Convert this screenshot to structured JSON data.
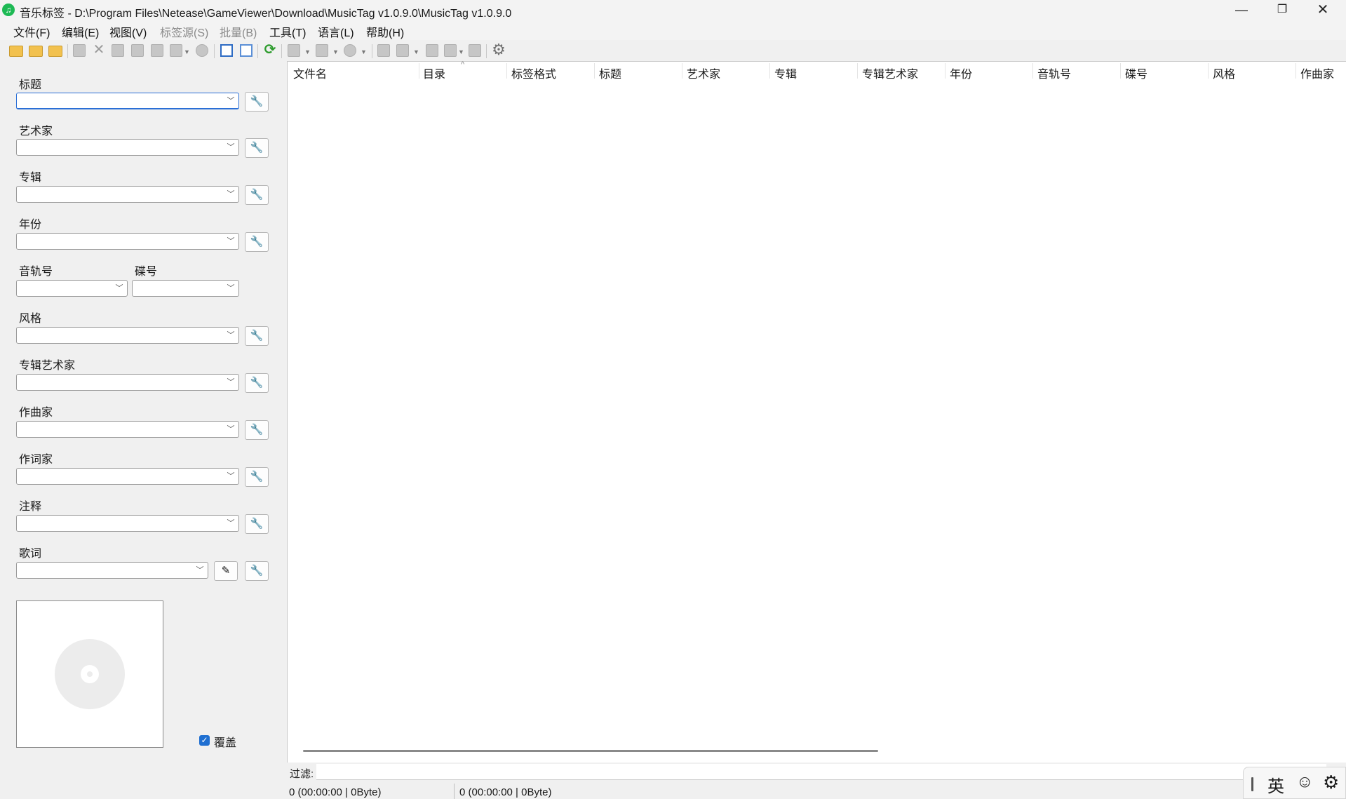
{
  "window": {
    "title": "音乐标签 - D:\\Program Files\\Netease\\GameViewer\\Download\\MusicTag v1.0.9.0\\MusicTag v1.0.9.0",
    "app_icon_glyph": "♫",
    "minimize_glyph": "—",
    "maximize_glyph": "❐",
    "close_glyph": "✕"
  },
  "menu": [
    "文件(F)",
    "编辑(E)",
    "视图(V)",
    "标签源(S)",
    "批量(B)",
    "工具(T)",
    "语言(L)",
    "帮助(H)"
  ],
  "menu_disabled": [
    "标签源(S)",
    "批量(B)"
  ],
  "toolbar_icons": [
    "open-folder-icon",
    "add-folder-icon",
    "open-subfolder-icon",
    "save-icon",
    "delete-icon",
    "undo-icon",
    "book-icon",
    "tag-tool-icon",
    "filter-tool-icon",
    "history-icon",
    "grid-view-icon",
    "list-grid-icon",
    "refresh-icon",
    "export-icon",
    "table-export-icon",
    "cd-icon",
    "tools-icon",
    "copy-icon",
    "rename-icon",
    "filter-icon",
    "convert-icon",
    "settings-icon"
  ],
  "fields": {
    "title": {
      "label": "标题",
      "value": ""
    },
    "artist": {
      "label": "艺术家",
      "value": ""
    },
    "album": {
      "label": "专辑",
      "value": ""
    },
    "year": {
      "label": "年份",
      "value": ""
    },
    "track": {
      "label": "音轨号",
      "value": ""
    },
    "disc": {
      "label": "碟号",
      "value": ""
    },
    "genre": {
      "label": "风格",
      "value": ""
    },
    "album_artist": {
      "label": "专辑艺术家",
      "value": ""
    },
    "composer": {
      "label": "作曲家",
      "value": ""
    },
    "lyricist": {
      "label": "作词家",
      "value": ""
    },
    "comment": {
      "label": "注释",
      "value": ""
    },
    "lyrics": {
      "label": "歌词",
      "value": ""
    }
  },
  "combo_arrow": "﹀",
  "wrench_glyph": "🔧",
  "edit_glyph": "✎",
  "overwrite": {
    "label": "覆盖",
    "checked": true,
    "glyph": "✓"
  },
  "columns": [
    "文件名",
    "目录",
    "标签格式",
    "标题",
    "艺术家",
    "专辑",
    "专辑艺术家",
    "年份",
    "音轨号",
    "碟号",
    "风格",
    "作曲家"
  ],
  "sort_indicator": "^",
  "filter": {
    "label": "过滤:",
    "value": ""
  },
  "status": {
    "left": "0 (00:00:00 | 0Byte)",
    "right": "0 (00:00:00 | 0Byte)"
  },
  "ime": {
    "lang": "英",
    "emoji": "☺",
    "settings": "⚙"
  },
  "colors": {
    "accent": "#2a6fd6",
    "checkbox": "#1f6fd1",
    "app_icon": "#1db954"
  }
}
